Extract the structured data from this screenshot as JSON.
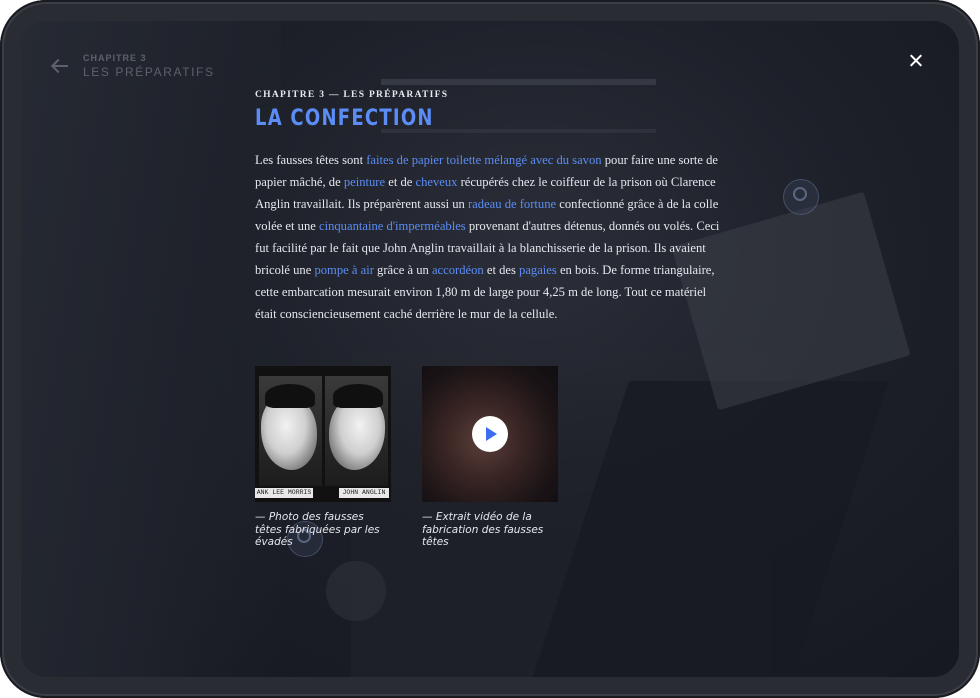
{
  "nav": {
    "back_chapter": "CHAPITRE 3",
    "back_title": "LES PRÉPARATIFS"
  },
  "header": {
    "kicker": "CHAPITRE 3 — LES PRÉPARATIFS",
    "title": "LA CONFECTION"
  },
  "body": {
    "p1": "Les fausses têtes sont ",
    "link_papier": "faites de papier toilette mélangé avec du savon",
    "p2": " pour faire une sorte de papier mâché, de ",
    "link_peinture": "peinture",
    "p3": " et de ",
    "link_cheveux": "cheveux",
    "p4": " récupérés chez le coiffeur de la prison où Clarence Anglin travaillait. Ils préparèrent aussi un ",
    "link_radeau": "radeau de fortune",
    "p5": " confectionné grâce à de la colle volée et une ",
    "link_impermeables": "cinquantaine d'imperméables",
    "p6": " provenant d'autres détenus, donnés ou volés. Ceci fut facilité par le fait que John Anglin travaillait à la blanchisserie de la prison. Ils avaient bricolé une ",
    "link_pompe": "pompe à air",
    "p7": " grâce à un ",
    "link_accordeon": "accordéon",
    "p8": " et des ",
    "link_pagaies": "pagaies",
    "p9": " en bois. De forme triangulaire, cette embarcation mesurait environ 1,80 m de large pour 4,25 m de long. Tout ce matériel était consciencieusement caché derrière le mur de la cellule."
  },
  "media": {
    "photo_tag_left": "ANK LEE MORRIS",
    "photo_tag_right": "JOHN ANGLIN",
    "photo_caption": "— Photo des fausses têtes fabriquées par les évadés",
    "video_caption": "— Extrait vidéo de la fabrication des fausses têtes"
  },
  "colors": {
    "accent": "#5b8df5",
    "background": "#1d2029",
    "text": "#e6e8ee"
  },
  "icons": [
    "back-arrow-icon",
    "close-icon",
    "play-icon",
    "search-icon"
  ]
}
